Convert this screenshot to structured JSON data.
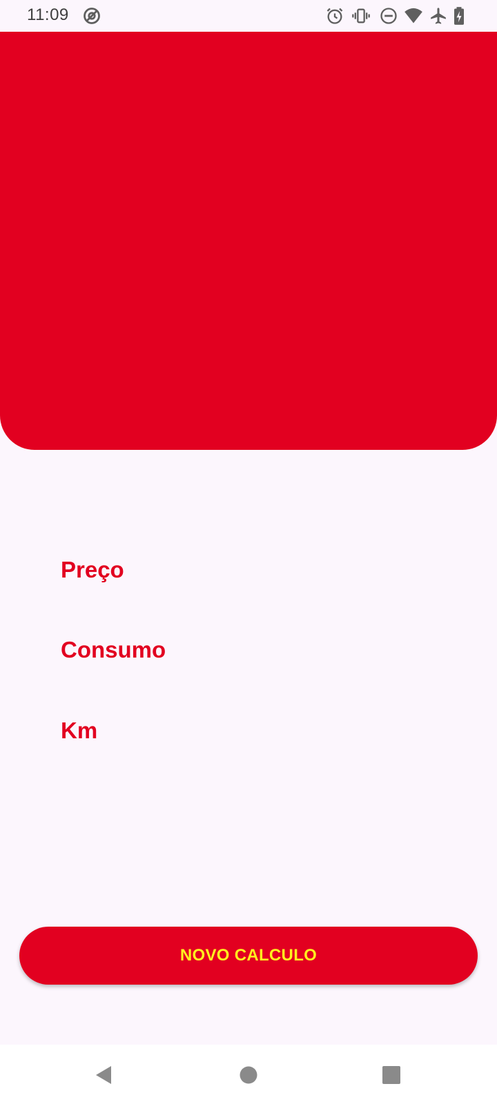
{
  "colors": {
    "primary": "#e20020",
    "button_text": "#fff21e",
    "background": "#fcf6fd",
    "status_icons": "#5f5f5f",
    "nav_icons": "#8a8a8a"
  },
  "status_bar": {
    "time": "11:09",
    "icons": [
      "at-sign-icon",
      "alarm-icon",
      "vibrate-icon",
      "do-not-disturb-icon",
      "wifi-icon",
      "airplane-icon",
      "battery-charging-icon"
    ]
  },
  "labels": {
    "price": "Preço",
    "consumption": "Consumo",
    "km": "Km"
  },
  "button": {
    "label": "NOVO CALCULO"
  },
  "nav": {
    "icons": [
      "back-icon",
      "home-icon",
      "recents-icon"
    ]
  }
}
